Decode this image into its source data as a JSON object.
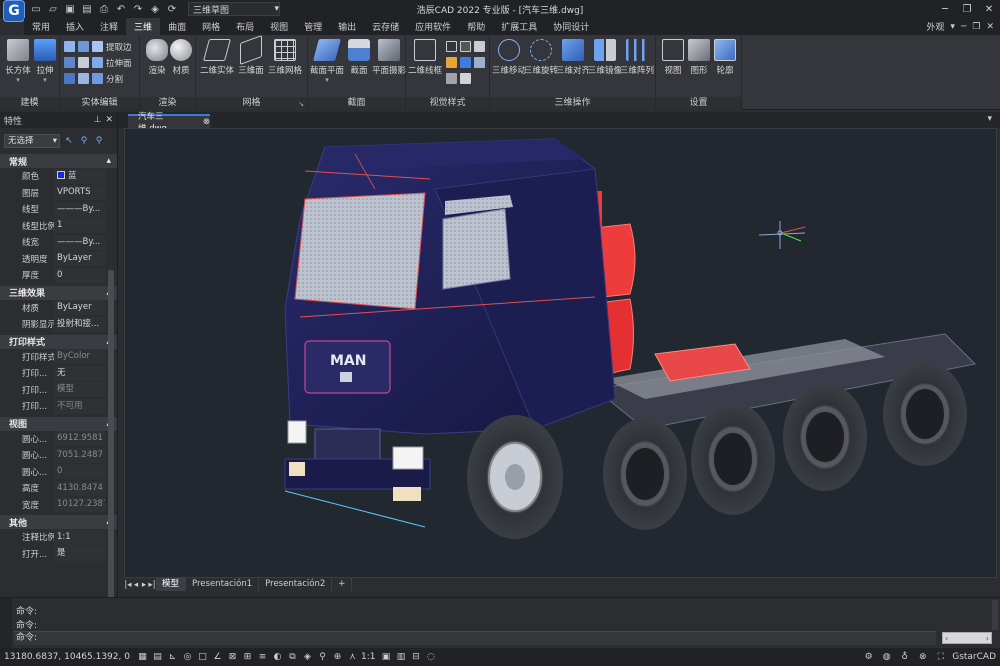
{
  "app": {
    "logo": "G",
    "title": "浩辰CAD 2022 专业版 - [汽车三维.dwg]",
    "workspace": "三维草图"
  },
  "menu": {
    "items": [
      "常用",
      "插入",
      "注释",
      "三维",
      "曲面",
      "网格",
      "布局",
      "视图",
      "管理",
      "输出",
      "云存储",
      "应用软件",
      "帮助",
      "扩展工具",
      "协同设计"
    ],
    "active_index": 3,
    "appearance": "外观"
  },
  "ribbon": {
    "groups": [
      {
        "label": "建模",
        "buttons": [
          "长方体",
          "拉伸"
        ]
      },
      {
        "label": "实体编辑",
        "buttons": [
          "提取边",
          "拉伸面",
          "分割"
        ]
      },
      {
        "label": "渲染",
        "buttons": [
          "渲染",
          "材质"
        ]
      },
      {
        "label": "网格",
        "buttons": [
          "二维实体",
          "三维面",
          "三维网格"
        ]
      },
      {
        "label": "截面",
        "buttons": [
          "截面平面",
          "截面",
          "平面摄影"
        ]
      },
      {
        "label": "视觉样式",
        "buttons": [
          "二维线框"
        ]
      },
      {
        "label": "三维操作",
        "buttons": [
          "三维移动",
          "三维旋转",
          "三维对齐",
          "三维镜像",
          "三维阵列"
        ]
      },
      {
        "label": "设置",
        "buttons": [
          "视图",
          "图形",
          "轮廓"
        ]
      }
    ]
  },
  "properties": {
    "title": "特性",
    "selection": "无选择",
    "sections": [
      {
        "title": "常规",
        "rows": [
          {
            "k": "颜色",
            "v": "蓝",
            "swatch": "#1a2ad8"
          },
          {
            "k": "图层",
            "v": "VPORTS"
          },
          {
            "k": "线型",
            "v": "———By..."
          },
          {
            "k": "线型比例",
            "v": "1"
          },
          {
            "k": "线宽",
            "v": "———By..."
          },
          {
            "k": "透明度",
            "v": "ByLayer"
          },
          {
            "k": "厚度",
            "v": "0"
          }
        ]
      },
      {
        "title": "三维效果",
        "rows": [
          {
            "k": "材质",
            "v": "ByLayer"
          },
          {
            "k": "阴影显示",
            "v": "投射和接..."
          }
        ]
      },
      {
        "title": "打印样式",
        "rows": [
          {
            "k": "打印样式",
            "v": "ByColor",
            "dim": true
          },
          {
            "k": "打印...",
            "v": "无"
          },
          {
            "k": "打印...",
            "v": "模型",
            "dim": true
          },
          {
            "k": "打印...",
            "v": "不可用",
            "dim": true
          }
        ]
      },
      {
        "title": "视图",
        "rows": [
          {
            "k": "圆心...",
            "v": "6912.9581",
            "dim": true
          },
          {
            "k": "圆心...",
            "v": "7051.2487",
            "dim": true
          },
          {
            "k": "圆心...",
            "v": "0",
            "dim": true
          },
          {
            "k": "高度",
            "v": "4130.8474",
            "dim": true
          },
          {
            "k": "宽度",
            "v": "10127.2387",
            "dim": true
          }
        ]
      },
      {
        "title": "其他",
        "rows": [
          {
            "k": "注释比例",
            "v": "1:1"
          },
          {
            "k": "打开...",
            "v": "是"
          }
        ]
      }
    ]
  },
  "document": {
    "tab": "汽车三维.dwg",
    "close": "⊗"
  },
  "layouts": [
    "模型",
    "Presentación1",
    "Presentación2",
    "+"
  ],
  "truck": {
    "brand": "MAN"
  },
  "command": {
    "lines": [
      "命令:",
      "命令:"
    ],
    "prompt": "命令:"
  },
  "status": {
    "coords": "13180.6837, 10465.1392, 0",
    "scale": "1:1",
    "brand": "GstarCAD"
  },
  "colors": {
    "cab": "#1e1f55",
    "accent": "#3e7bd6",
    "tank": "#ee3b3b"
  }
}
